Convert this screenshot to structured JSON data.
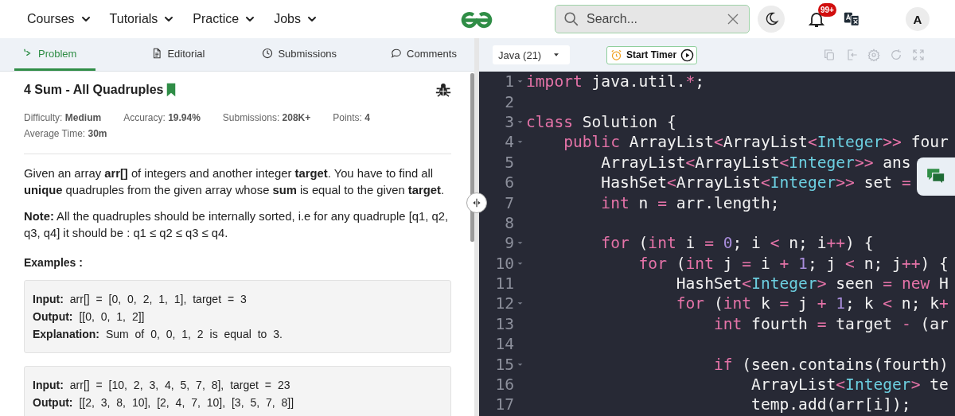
{
  "nav": {
    "menus": [
      {
        "label": "Courses"
      },
      {
        "label": "Tutorials"
      },
      {
        "label": "Practice"
      },
      {
        "label": "Jobs"
      }
    ],
    "search": {
      "placeholder": "Search..."
    },
    "notifications": {
      "badge": "99+"
    },
    "avatar": {
      "initial": "A"
    }
  },
  "problem_tabs": [
    {
      "label": "Problem",
      "selected": true
    },
    {
      "label": "Editorial",
      "selected": false
    },
    {
      "label": "Submissions",
      "selected": false
    },
    {
      "label": "Comments",
      "selected": false
    }
  ],
  "problem": {
    "title": "4 Sum - All Quadruples",
    "bookmarked": true,
    "stats": [
      {
        "label": "Difficulty:",
        "value": "Medium"
      },
      {
        "label": "Accuracy:",
        "value": "19.94%"
      },
      {
        "label": "Submissions:",
        "value": "208K+"
      },
      {
        "label": "Points:",
        "value": "4"
      },
      {
        "label": "Average Time:",
        "value": "30m"
      }
    ],
    "paragraphs": [
      "Given an array **arr[]** of integers and another integer **target**. You have to find all **unique** quadruples from the given array whose **sum** is equal to the given **target**.",
      "**Note:** All the quadruples should be internally sorted, i.e for any quadruple [q1, q2, q3, q4] it should be : q1 ≤ q2 ≤ q3 ≤ q4."
    ],
    "examples_heading": "Examples :",
    "examples": [
      {
        "lines": [
          {
            "label": "Input:",
            "value": "arr[] = [0, 0, 2, 1, 1], target = 3"
          },
          {
            "label": "Output:",
            "value": "[[0, 0, 1, 2]]"
          },
          {
            "label": "Explanation:",
            "value": "Sum of 0, 0, 1, 2 is equal to 3."
          }
        ]
      },
      {
        "lines": [
          {
            "label": "Input:",
            "value": "arr[] = [10, 2, 3, 4, 5, 7, 8], target = 23"
          },
          {
            "label": "Output:",
            "value": "[[2, 3, 8, 10], [2, 4, 7, 10], [3, 5, 7, 8]]"
          }
        ]
      }
    ]
  },
  "editor": {
    "language": "Java (21)",
    "timer_button": "Start Timer",
    "lines": [
      {
        "number": "1",
        "fold": true,
        "tokens": [
          {
            "kind": "kw",
            "text": "import"
          },
          {
            "kind": "plain",
            "text": " java.util."
          },
          {
            "kind": "op",
            "text": "*"
          },
          {
            "kind": "plain",
            "text": ";"
          }
        ]
      },
      {
        "number": "2",
        "fold": false
      },
      {
        "number": "3",
        "fold": true,
        "tokens": [
          {
            "kind": "kw",
            "text": "class"
          },
          {
            "kind": "plain",
            "text": " Solution {"
          }
        ]
      },
      {
        "number": "4",
        "fold": true,
        "tokens": [
          {
            "kind": "kw",
            "text": "    public"
          },
          {
            "kind": "plain",
            "text": " ArrayList"
          },
          {
            "kind": "op",
            "text": "<"
          },
          {
            "kind": "plain",
            "text": "ArrayList"
          },
          {
            "kind": "op",
            "text": "<"
          },
          {
            "kind": "type",
            "text": "Integer"
          },
          {
            "kind": "op",
            "text": ">>"
          },
          {
            "kind": "plain",
            "text": " four"
          }
        ]
      },
      {
        "number": "5",
        "fold": false,
        "tokens": [
          {
            "kind": "plain",
            "text": "        ArrayList"
          },
          {
            "kind": "op",
            "text": "<"
          },
          {
            "kind": "plain",
            "text": "ArrayList"
          },
          {
            "kind": "op",
            "text": "<"
          },
          {
            "kind": "type",
            "text": "Integer"
          },
          {
            "kind": "op",
            "text": ">>"
          },
          {
            "kind": "plain",
            "text": " ans"
          }
        ]
      },
      {
        "number": "6",
        "fold": false,
        "tokens": [
          {
            "kind": "plain",
            "text": "        HashSet"
          },
          {
            "kind": "op",
            "text": "<"
          },
          {
            "kind": "plain",
            "text": "ArrayList"
          },
          {
            "kind": "op",
            "text": "<"
          },
          {
            "kind": "type",
            "text": "Integer"
          },
          {
            "kind": "op",
            "text": ">>"
          },
          {
            "kind": "plain",
            "text": " set "
          },
          {
            "kind": "op",
            "text": "="
          }
        ]
      },
      {
        "number": "7",
        "fold": false,
        "tokens": [
          {
            "kind": "kw",
            "text": "        int"
          },
          {
            "kind": "plain",
            "text": " n "
          },
          {
            "kind": "op",
            "text": "="
          },
          {
            "kind": "plain",
            "text": " arr.length;"
          }
        ]
      },
      {
        "number": "8",
        "fold": false
      },
      {
        "number": "9",
        "fold": true,
        "tokens": [
          {
            "kind": "kw",
            "text": "        for"
          },
          {
            "kind": "plain",
            "text": " ("
          },
          {
            "kind": "kw",
            "text": "int"
          },
          {
            "kind": "plain",
            "text": " i "
          },
          {
            "kind": "op",
            "text": "= "
          },
          {
            "kind": "num",
            "text": "0"
          },
          {
            "kind": "plain",
            "text": "; i "
          },
          {
            "kind": "op",
            "text": "<"
          },
          {
            "kind": "plain",
            "text": " n; i"
          },
          {
            "kind": "op",
            "text": "++"
          },
          {
            "kind": "plain",
            "text": ") {"
          }
        ]
      },
      {
        "number": "10",
        "fold": true,
        "tokens": [
          {
            "kind": "kw",
            "text": "            for"
          },
          {
            "kind": "plain",
            "text": " ("
          },
          {
            "kind": "kw",
            "text": "int"
          },
          {
            "kind": "plain",
            "text": " j "
          },
          {
            "kind": "op",
            "text": "="
          },
          {
            "kind": "plain",
            "text": " i "
          },
          {
            "kind": "op",
            "text": "+ "
          },
          {
            "kind": "num",
            "text": "1"
          },
          {
            "kind": "plain",
            "text": "; j "
          },
          {
            "kind": "op",
            "text": "<"
          },
          {
            "kind": "plain",
            "text": " n; j"
          },
          {
            "kind": "op",
            "text": "++"
          },
          {
            "kind": "plain",
            "text": ") {"
          }
        ]
      },
      {
        "number": "11",
        "fold": false,
        "tokens": [
          {
            "kind": "plain",
            "text": "                HashSet"
          },
          {
            "kind": "op",
            "text": "<"
          },
          {
            "kind": "type",
            "text": "Integer"
          },
          {
            "kind": "op",
            "text": ">"
          },
          {
            "kind": "plain",
            "text": " seen "
          },
          {
            "kind": "op",
            "text": "= "
          },
          {
            "kind": "kw",
            "text": "new"
          },
          {
            "kind": "plain",
            "text": " H"
          }
        ]
      },
      {
        "number": "12",
        "fold": true,
        "tokens": [
          {
            "kind": "kw",
            "text": "                for"
          },
          {
            "kind": "plain",
            "text": " ("
          },
          {
            "kind": "kw",
            "text": "int"
          },
          {
            "kind": "plain",
            "text": " k "
          },
          {
            "kind": "op",
            "text": "="
          },
          {
            "kind": "plain",
            "text": " j "
          },
          {
            "kind": "op",
            "text": "+ "
          },
          {
            "kind": "num",
            "text": "1"
          },
          {
            "kind": "plain",
            "text": "; k "
          },
          {
            "kind": "op",
            "text": "<"
          },
          {
            "kind": "plain",
            "text": " n; k"
          },
          {
            "kind": "op",
            "text": "+"
          }
        ]
      },
      {
        "number": "13",
        "fold": false,
        "tokens": [
          {
            "kind": "kw",
            "text": "                    int"
          },
          {
            "kind": "plain",
            "text": " fourth "
          },
          {
            "kind": "op",
            "text": "="
          },
          {
            "kind": "plain",
            "text": " target "
          },
          {
            "kind": "op",
            "text": "-"
          },
          {
            "kind": "plain",
            "text": " (ar"
          }
        ]
      },
      {
        "number": "14",
        "fold": false
      },
      {
        "number": "15",
        "fold": true,
        "tokens": [
          {
            "kind": "kw",
            "text": "                    if"
          },
          {
            "kind": "plain",
            "text": " (seen.contains(fourth)"
          }
        ]
      },
      {
        "number": "16",
        "fold": false,
        "tokens": [
          {
            "kind": "plain",
            "text": "                        ArrayList"
          },
          {
            "kind": "op",
            "text": "<"
          },
          {
            "kind": "type",
            "text": "Integer"
          },
          {
            "kind": "op",
            "text": ">"
          },
          {
            "kind": "plain",
            "text": " te"
          }
        ]
      },
      {
        "number": "17",
        "fold": false,
        "tokens": [
          {
            "kind": "plain",
            "text": "                        temp.add(arr[i]);"
          }
        ]
      }
    ]
  }
}
